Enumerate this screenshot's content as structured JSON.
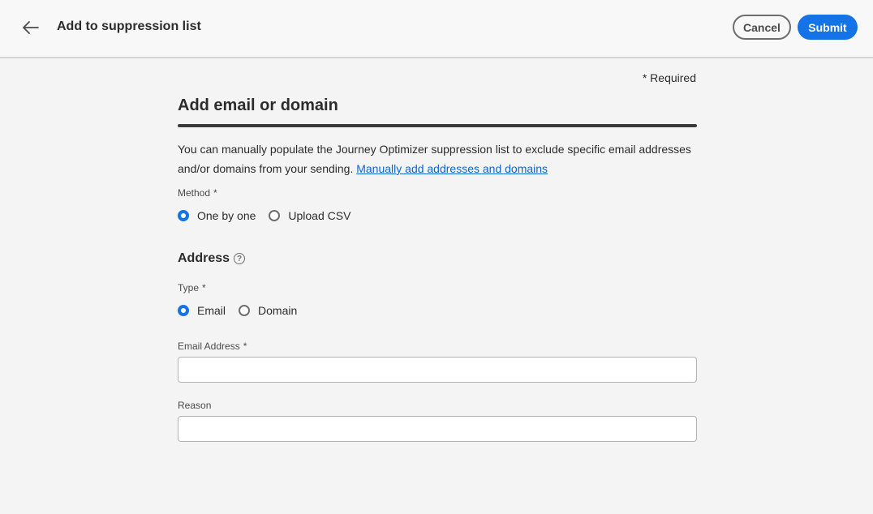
{
  "header": {
    "title": "Add to suppression list",
    "cancel_label": "Cancel",
    "submit_label": "Submit"
  },
  "form": {
    "required_note": "* Required",
    "section_title": "Add email or domain",
    "description_text": "You can manually populate the Journey Optimizer suppression list to exclude specific email addresses and/or domains from your sending.",
    "description_link": "Manually add addresses and domains",
    "method": {
      "label": "Method",
      "required_mark": "*",
      "options": [
        {
          "label": "One by one",
          "checked": true
        },
        {
          "label": "Upload CSV",
          "checked": false
        }
      ]
    },
    "address": {
      "title": "Address",
      "help_icon": "?"
    },
    "type": {
      "label": "Type",
      "required_mark": "*",
      "options": [
        {
          "label": "Email",
          "checked": true
        },
        {
          "label": "Domain",
          "checked": false
        }
      ]
    },
    "email_address": {
      "label": "Email Address",
      "required_mark": "*",
      "value": "",
      "placeholder": ""
    },
    "reason": {
      "label": "Reason",
      "value": "",
      "placeholder": ""
    }
  },
  "colors": {
    "accent": "#1473e6",
    "link": "#0d66d0",
    "background": "#f4f4f4"
  }
}
